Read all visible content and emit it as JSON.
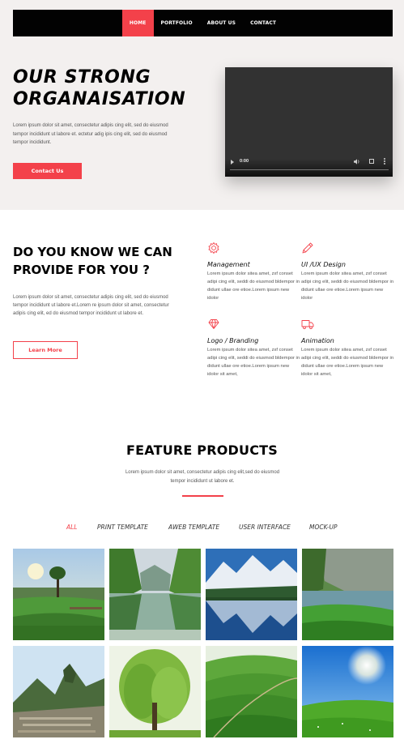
{
  "nav": {
    "items": [
      {
        "label": "HOME",
        "active": true
      },
      {
        "label": "PORTFOLIO",
        "active": false
      },
      {
        "label": "ABOUT US",
        "active": false
      },
      {
        "label": "CONTACT",
        "active": false
      }
    ]
  },
  "hero": {
    "title_line1": "OUR STRONG",
    "title_line2": "ORGANAISATION",
    "text": "Lorem ipsum dolor sit amet, consectetur adipis cing elit, sed do eiusmod tempor incididunt ut labore et. ectetur adig ipis cing elit, sed do eiusmod tempor incididunt.",
    "button_label": "Contact Us",
    "video": {
      "time": "0:00",
      "progress": 0
    }
  },
  "know": {
    "title": "DO YOU KNOW WE CAN PROVIDE FOR YOU ?",
    "text": "Lorem ipsum dolor sit amet, consectetur adipis cing elit, sed do eiusmod tempor incididunt ut labore et.Lorem re ipsum dolor sit amet, consectetur adipis cing elit, ed do eiusmod tempor incididunt ut labore et.",
    "button_label": "Learn More"
  },
  "services": [
    {
      "icon": "gear-icon",
      "title": "Management",
      "text": "Lorem ipsum dolor sitea amet, zxf conset adipi cing elit, seddi do eiusmod bldempor in didunt ullae ore etioe.Lorem ipsum new idolor"
    },
    {
      "icon": "pencil-icon",
      "title": "UI /UX Design",
      "text": "Lorem ipsum dolor sitea amet, zxf conset adipi cing elit, seddi do eiusmod bldempor in didunt ullae ore etioe.Lorem ipsum new idolor"
    },
    {
      "icon": "diamond-icon",
      "title": "Logo / Branding",
      "text": "Lorem ipsum dolor sitea amet, zxf conset adipi cing elit, seddi do eiusmod bldempor in didunt ullae ore etioe.Lorem ipsum new idolor sit amet,"
    },
    {
      "icon": "truck-icon",
      "title": "Animation",
      "text": "Lorem ipsum dolor sitea amet, zxf conset adipi cing elit, seddi do eiusmod bldempor in didunt ullae ore etioe.Lorem ipsum new idolor sit amet,"
    }
  ],
  "features": {
    "title": "FEATURE PRODUCTS",
    "text": "Lorem ipsum dolor sit amet, consectetur adipis cing elit,sed do eiusmod tempor incididunt ut labore et.",
    "filters": [
      {
        "label": "ALL",
        "active": true
      },
      {
        "label": "PRINT TEMPLATE",
        "active": false
      },
      {
        "label": "AWEB TEMPLATE",
        "active": false
      },
      {
        "label": "USER INTERFACE",
        "active": false
      },
      {
        "label": "MOCK-UP",
        "active": false
      }
    ]
  },
  "colors": {
    "accent": "#f3414a",
    "nav_bg": "#020202",
    "hero_bg": "#f3f0ef"
  }
}
